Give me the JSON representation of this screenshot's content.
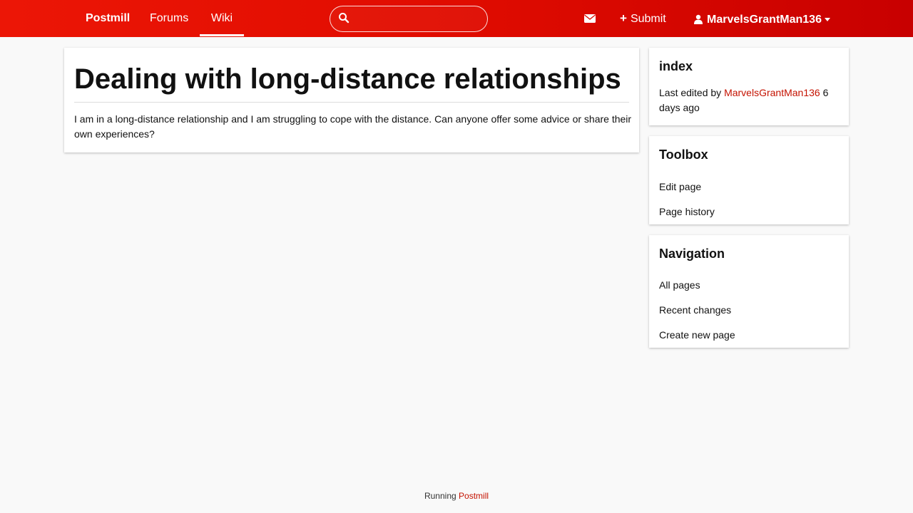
{
  "header": {
    "brand": "Postmill",
    "nav": {
      "forums": "Forums",
      "wiki": "Wiki"
    },
    "search": {
      "placeholder": "",
      "value": ""
    },
    "submit_label": "Submit",
    "username": "MarvelsGrantMan136",
    "accent_color": "#e00c00"
  },
  "main": {
    "title": "Dealing with long-distance relationships",
    "body": "I am in a long-distance relationship and I am struggling to cope with the distance. Can anyone offer some advice or share their own experiences?"
  },
  "sidebar": {
    "index": {
      "heading": "index",
      "edited_prefix": "Last edited by",
      "edited_user": "MarvelsGrantMan136",
      "edited_time": "6 days ago"
    },
    "toolbox": {
      "heading": "Toolbox",
      "edit_page": "Edit page",
      "page_history": "Page history"
    },
    "navigation": {
      "heading": "Navigation",
      "all_pages": "All pages",
      "recent_changes": "Recent changes",
      "create_new_page": "Create new page"
    }
  },
  "footer": {
    "prefix": "Running",
    "link": "Postmill",
    "link_color": "#c41200"
  },
  "icons": [
    "search-icon",
    "mail-icon",
    "plus-icon",
    "user-icon",
    "caret-down-icon"
  ]
}
